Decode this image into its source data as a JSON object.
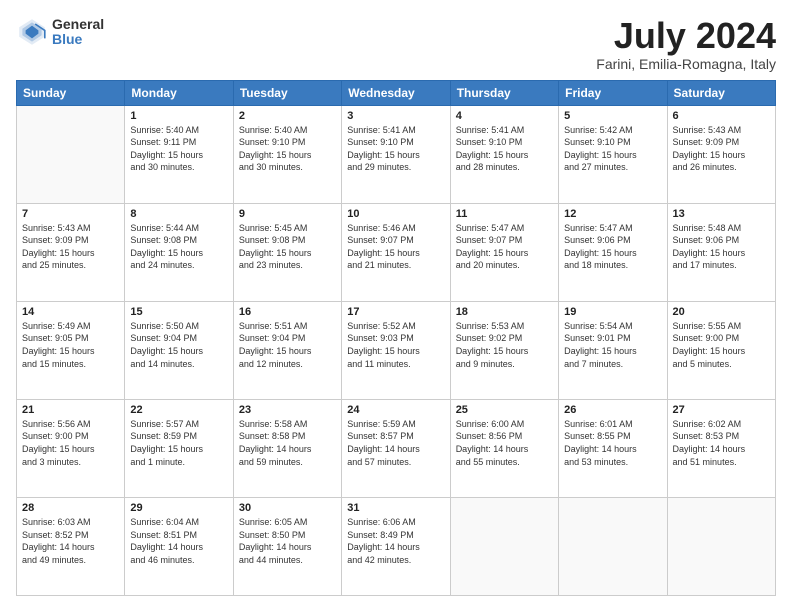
{
  "header": {
    "logo_general": "General",
    "logo_blue": "Blue",
    "title": "July 2024",
    "subtitle": "Farini, Emilia-Romagna, Italy"
  },
  "days_of_week": [
    "Sunday",
    "Monday",
    "Tuesday",
    "Wednesday",
    "Thursday",
    "Friday",
    "Saturday"
  ],
  "weeks": [
    [
      {
        "day": "",
        "info": ""
      },
      {
        "day": "1",
        "info": "Sunrise: 5:40 AM\nSunset: 9:11 PM\nDaylight: 15 hours\nand 30 minutes."
      },
      {
        "day": "2",
        "info": "Sunrise: 5:40 AM\nSunset: 9:10 PM\nDaylight: 15 hours\nand 30 minutes."
      },
      {
        "day": "3",
        "info": "Sunrise: 5:41 AM\nSunset: 9:10 PM\nDaylight: 15 hours\nand 29 minutes."
      },
      {
        "day": "4",
        "info": "Sunrise: 5:41 AM\nSunset: 9:10 PM\nDaylight: 15 hours\nand 28 minutes."
      },
      {
        "day": "5",
        "info": "Sunrise: 5:42 AM\nSunset: 9:10 PM\nDaylight: 15 hours\nand 27 minutes."
      },
      {
        "day": "6",
        "info": "Sunrise: 5:43 AM\nSunset: 9:09 PM\nDaylight: 15 hours\nand 26 minutes."
      }
    ],
    [
      {
        "day": "7",
        "info": "Sunrise: 5:43 AM\nSunset: 9:09 PM\nDaylight: 15 hours\nand 25 minutes."
      },
      {
        "day": "8",
        "info": "Sunrise: 5:44 AM\nSunset: 9:08 PM\nDaylight: 15 hours\nand 24 minutes."
      },
      {
        "day": "9",
        "info": "Sunrise: 5:45 AM\nSunset: 9:08 PM\nDaylight: 15 hours\nand 23 minutes."
      },
      {
        "day": "10",
        "info": "Sunrise: 5:46 AM\nSunset: 9:07 PM\nDaylight: 15 hours\nand 21 minutes."
      },
      {
        "day": "11",
        "info": "Sunrise: 5:47 AM\nSunset: 9:07 PM\nDaylight: 15 hours\nand 20 minutes."
      },
      {
        "day": "12",
        "info": "Sunrise: 5:47 AM\nSunset: 9:06 PM\nDaylight: 15 hours\nand 18 minutes."
      },
      {
        "day": "13",
        "info": "Sunrise: 5:48 AM\nSunset: 9:06 PM\nDaylight: 15 hours\nand 17 minutes."
      }
    ],
    [
      {
        "day": "14",
        "info": "Sunrise: 5:49 AM\nSunset: 9:05 PM\nDaylight: 15 hours\nand 15 minutes."
      },
      {
        "day": "15",
        "info": "Sunrise: 5:50 AM\nSunset: 9:04 PM\nDaylight: 15 hours\nand 14 minutes."
      },
      {
        "day": "16",
        "info": "Sunrise: 5:51 AM\nSunset: 9:04 PM\nDaylight: 15 hours\nand 12 minutes."
      },
      {
        "day": "17",
        "info": "Sunrise: 5:52 AM\nSunset: 9:03 PM\nDaylight: 15 hours\nand 11 minutes."
      },
      {
        "day": "18",
        "info": "Sunrise: 5:53 AM\nSunset: 9:02 PM\nDaylight: 15 hours\nand 9 minutes."
      },
      {
        "day": "19",
        "info": "Sunrise: 5:54 AM\nSunset: 9:01 PM\nDaylight: 15 hours\nand 7 minutes."
      },
      {
        "day": "20",
        "info": "Sunrise: 5:55 AM\nSunset: 9:00 PM\nDaylight: 15 hours\nand 5 minutes."
      }
    ],
    [
      {
        "day": "21",
        "info": "Sunrise: 5:56 AM\nSunset: 9:00 PM\nDaylight: 15 hours\nand 3 minutes."
      },
      {
        "day": "22",
        "info": "Sunrise: 5:57 AM\nSunset: 8:59 PM\nDaylight: 15 hours\nand 1 minute."
      },
      {
        "day": "23",
        "info": "Sunrise: 5:58 AM\nSunset: 8:58 PM\nDaylight: 14 hours\nand 59 minutes."
      },
      {
        "day": "24",
        "info": "Sunrise: 5:59 AM\nSunset: 8:57 PM\nDaylight: 14 hours\nand 57 minutes."
      },
      {
        "day": "25",
        "info": "Sunrise: 6:00 AM\nSunset: 8:56 PM\nDaylight: 14 hours\nand 55 minutes."
      },
      {
        "day": "26",
        "info": "Sunrise: 6:01 AM\nSunset: 8:55 PM\nDaylight: 14 hours\nand 53 minutes."
      },
      {
        "day": "27",
        "info": "Sunrise: 6:02 AM\nSunset: 8:53 PM\nDaylight: 14 hours\nand 51 minutes."
      }
    ],
    [
      {
        "day": "28",
        "info": "Sunrise: 6:03 AM\nSunset: 8:52 PM\nDaylight: 14 hours\nand 49 minutes."
      },
      {
        "day": "29",
        "info": "Sunrise: 6:04 AM\nSunset: 8:51 PM\nDaylight: 14 hours\nand 46 minutes."
      },
      {
        "day": "30",
        "info": "Sunrise: 6:05 AM\nSunset: 8:50 PM\nDaylight: 14 hours\nand 44 minutes."
      },
      {
        "day": "31",
        "info": "Sunrise: 6:06 AM\nSunset: 8:49 PM\nDaylight: 14 hours\nand 42 minutes."
      },
      {
        "day": "",
        "info": ""
      },
      {
        "day": "",
        "info": ""
      },
      {
        "day": "",
        "info": ""
      }
    ]
  ]
}
